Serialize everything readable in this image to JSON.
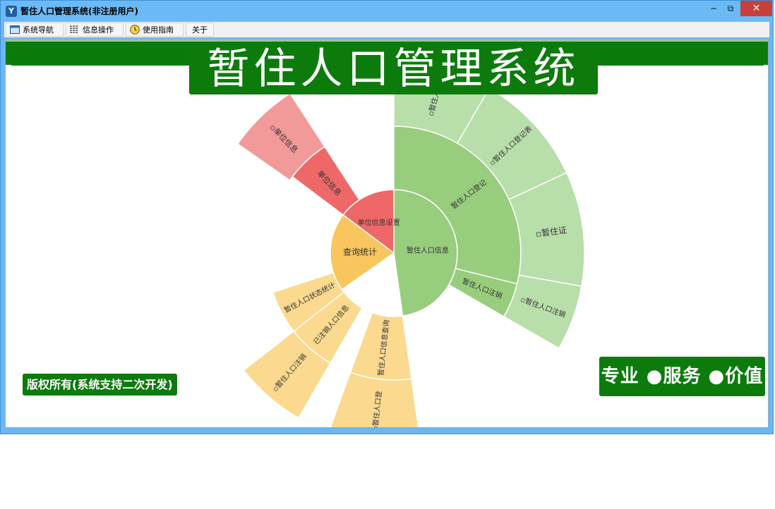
{
  "window": {
    "title": "暂住人口管理系统(非注册用户)",
    "buttons": {
      "minimize": "−",
      "maximize": "⧉",
      "close": "✕"
    }
  },
  "menu": {
    "items": [
      {
        "label": "系统导航",
        "icon": "window-icon"
      },
      {
        "label": "信息操作",
        "icon": "grid-icon"
      },
      {
        "label": "使用指南",
        "icon": "clock-icon"
      },
      {
        "label": "关于",
        "icon": ""
      }
    ]
  },
  "banner": {
    "title": "暂住人口管理系统"
  },
  "footer": {
    "copyright": "版权所有(系统支持二次开发)",
    "slogan": "专业 ●服务 ●价值"
  },
  "colors": {
    "title_green": "#0c7b0c",
    "red_inner": "#ee6868",
    "red_outer": "#f2999a",
    "yellow_inner": "#f8c65c",
    "yellow_outer": "#fbd98f",
    "green_inner": "#97cd7c",
    "green_outer": "#b8deaa"
  },
  "sunburst": {
    "root": [
      {
        "id": "r1",
        "label": "单位信息设置"
      },
      {
        "id": "r2",
        "label": "查询统计"
      },
      {
        "id": "r3",
        "label": "暂住人口信息"
      }
    ],
    "ring1": [
      {
        "id": "a1",
        "label": "单位信息"
      },
      {
        "id": "a2",
        "label": "暂住人口状态统计"
      },
      {
        "id": "a3",
        "label": "已注销人口信息"
      },
      {
        "id": "a4",
        "label": "暂住人口信息查询"
      },
      {
        "id": "a5",
        "label": "暂住人口注销"
      },
      {
        "id": "a6",
        "label": "暂住人口登记"
      }
    ],
    "ring2": [
      {
        "id": "b1",
        "label": "▫单位信息"
      },
      {
        "id": "b2",
        "label": "▫暂住人口注销"
      },
      {
        "id": "b3",
        "label": "▫暂住人口登"
      },
      {
        "id": "b4",
        "label": "▫暂住人口注销"
      },
      {
        "id": "b5",
        "label": "▫暂住证"
      },
      {
        "id": "b6",
        "label": "▫暂住人口登记表"
      },
      {
        "id": "b7",
        "label": "▫暂住人口"
      }
    ]
  }
}
